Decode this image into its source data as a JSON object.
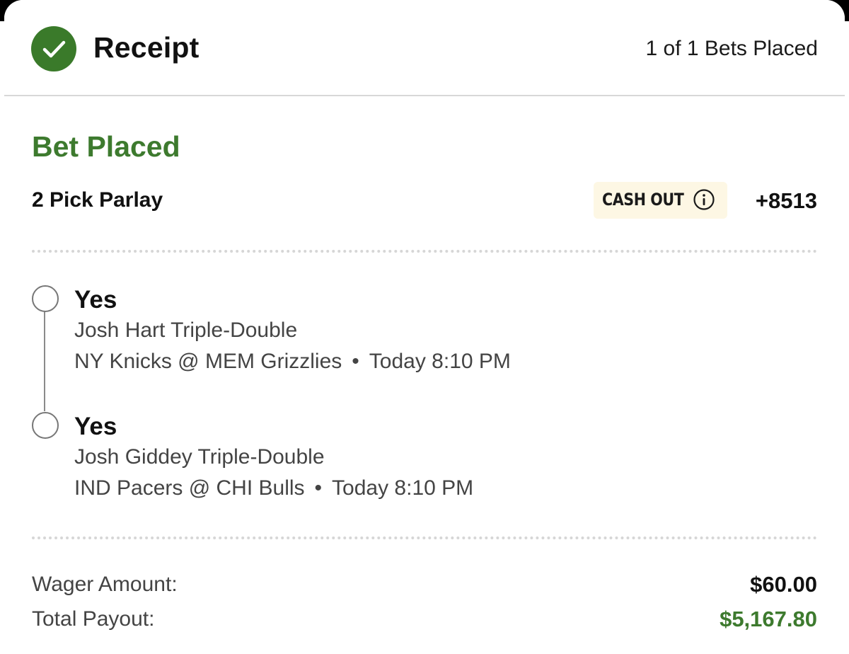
{
  "header": {
    "title": "Receipt",
    "bets_count": "1 of 1 Bets Placed"
  },
  "bet": {
    "status": "Bet Placed",
    "type": "2 Pick Parlay",
    "cashout_label": "CASH OUT",
    "odds": "+8513"
  },
  "legs": [
    {
      "pick": "Yes",
      "market": "Josh Hart Triple-Double",
      "event": "NY Knicks @ MEM Grizzlies",
      "separator": "•",
      "time": "Today 8:10 PM"
    },
    {
      "pick": "Yes",
      "market": "Josh Giddey Triple-Double",
      "event": "IND Pacers @ CHI Bulls",
      "separator": "•",
      "time": "Today 8:10 PM"
    }
  ],
  "totals": {
    "wager_label": "Wager Amount:",
    "wager_value": "$60.00",
    "payout_label": "Total Payout:",
    "payout_value": "$5,167.80"
  },
  "colors": {
    "brand_green": "#3d7a2e",
    "cashout_bg": "#fdf7e4",
    "payout_green": "#3d7a2e"
  },
  "icons": {
    "status": "check-circle-icon",
    "cashout_info": "info-icon",
    "leg_marker": "empty-circle-icon"
  }
}
